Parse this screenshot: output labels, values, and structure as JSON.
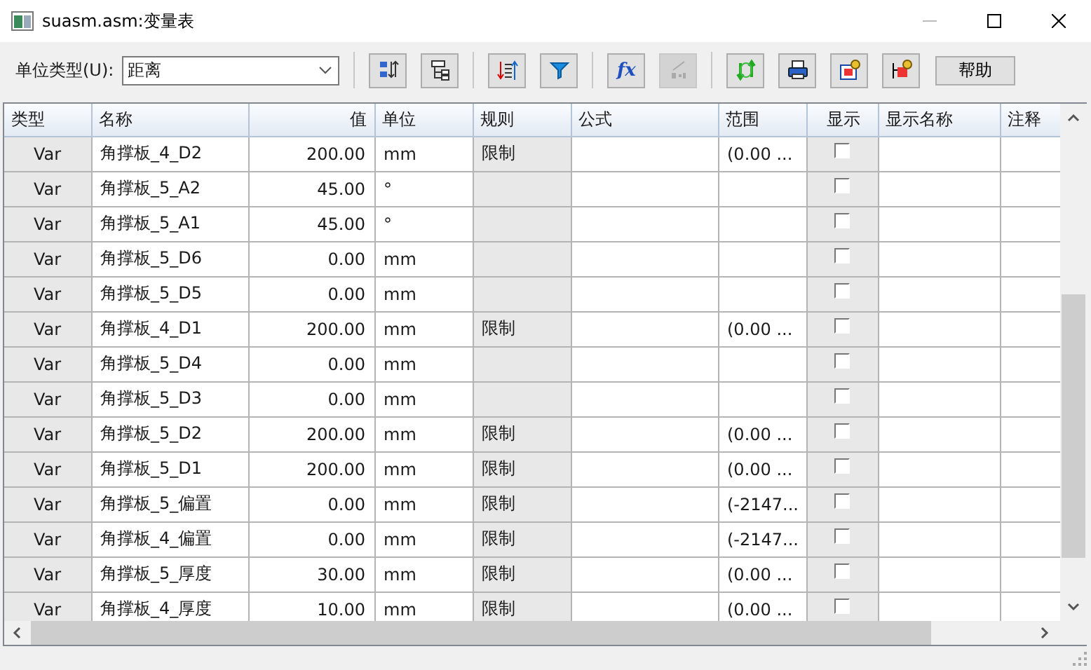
{
  "window": {
    "title": "suasm.asm:变量表"
  },
  "toolbar": {
    "unit_type_label": "单位类型(U):",
    "unit_type": "距离",
    "tools": [
      {
        "kind": "sort-alpha",
        "disabled": false
      },
      {
        "kind": "tree",
        "disabled": false
      },
      {
        "kind": "sort-order",
        "disabled": false
      },
      {
        "kind": "filter",
        "disabled": false
      },
      {
        "kind": "formula",
        "label": "fx",
        "disabled": false
      },
      {
        "kind": "ratio",
        "disabled": true
      },
      {
        "kind": "refresh",
        "disabled": false
      },
      {
        "kind": "print",
        "disabled": false
      },
      {
        "kind": "export",
        "disabled": false
      },
      {
        "kind": "import",
        "disabled": false
      }
    ],
    "help_button": "帮助"
  },
  "grid": {
    "columns": [
      "类型",
      "名称",
      "值",
      "单位",
      "规则",
      "公式",
      "范围",
      "显示",
      "显示名称",
      "注释"
    ],
    "rows": [
      {
        "type": "Var",
        "name": "角撑板_4_D2",
        "value": "200.00",
        "unit": "mm",
        "rule": "限制",
        "range": "(0.00 ...",
        "show": false
      },
      {
        "type": "Var",
        "name": "角撑板_5_A2",
        "value": "45.00",
        "unit": "°",
        "show": false
      },
      {
        "type": "Var",
        "name": "角撑板_5_A1",
        "value": "45.00",
        "unit": "°",
        "show": false
      },
      {
        "type": "Var",
        "name": "角撑板_5_D6",
        "value": "0.00",
        "unit": "mm",
        "show": false
      },
      {
        "type": "Var",
        "name": "角撑板_5_D5",
        "value": "0.00",
        "unit": "mm",
        "show": false
      },
      {
        "type": "Var",
        "name": "角撑板_4_D1",
        "value": "200.00",
        "unit": "mm",
        "rule": "限制",
        "range": "(0.00 ...",
        "show": false
      },
      {
        "type": "Var",
        "name": "角撑板_5_D4",
        "value": "0.00",
        "unit": "mm",
        "show": false
      },
      {
        "type": "Var",
        "name": "角撑板_5_D3",
        "value": "0.00",
        "unit": "mm",
        "show": false
      },
      {
        "type": "Var",
        "name": "角撑板_5_D2",
        "value": "200.00",
        "unit": "mm",
        "rule": "限制",
        "range": "(0.00 ...",
        "show": false
      },
      {
        "type": "Var",
        "name": "角撑板_5_D1",
        "value": "200.00",
        "unit": "mm",
        "rule": "限制",
        "range": "(0.00 ...",
        "show": false
      },
      {
        "type": "Var",
        "name": "角撑板_5_偏置",
        "value": "0.00",
        "unit": "mm",
        "rule": "限制",
        "range": "(-2147...",
        "show": false
      },
      {
        "type": "Var",
        "name": "角撑板_4_偏置",
        "value": "0.00",
        "unit": "mm",
        "rule": "限制",
        "range": "(-2147...",
        "show": false
      },
      {
        "type": "Var",
        "name": "角撑板_5_厚度",
        "value": "30.00",
        "unit": "mm",
        "rule": "限制",
        "range": "(0.00 ...",
        "show": false
      },
      {
        "type": "Var",
        "name": "角撑板_4_厚度",
        "value": "10.00",
        "unit": "mm",
        "rule": "限制",
        "range": "(0.00 ...",
        "show": false
      }
    ]
  }
}
